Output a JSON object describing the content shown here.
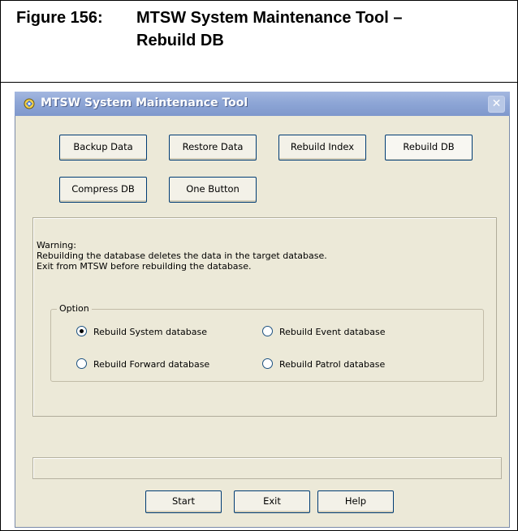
{
  "caption": {
    "number": "Figure 156:",
    "title_line1": "MTSW System Maintenance Tool –",
    "title_line2": "Rebuild DB"
  },
  "window": {
    "title": "MTSW System Maintenance Tool",
    "close_glyph": "✕"
  },
  "toolbar": {
    "backup": "Backup Data",
    "restore": "Restore Data",
    "rebuild_index": "Rebuild Index",
    "rebuild_db": "Rebuild DB",
    "compress": "Compress DB",
    "one_button": "One Button"
  },
  "warning": {
    "line1": "Warning:",
    "line2": "Rebuilding the database deletes the data in the target database.",
    "line3": "Exit from MTSW before rebuilding the database."
  },
  "option": {
    "legend": "Option",
    "rebuild_system": "Rebuild System database",
    "rebuild_event": "Rebuild Event database",
    "rebuild_forward": "Rebuild Forward database",
    "rebuild_patrol": "Rebuild Patrol database",
    "selected": "rebuild_system"
  },
  "footer": {
    "start": "Start",
    "exit": "Exit",
    "help": "Help"
  },
  "colors": {
    "window_bg": "#ece9d8",
    "titlebar": "#8ea6d6",
    "button_border": "#003c74"
  }
}
